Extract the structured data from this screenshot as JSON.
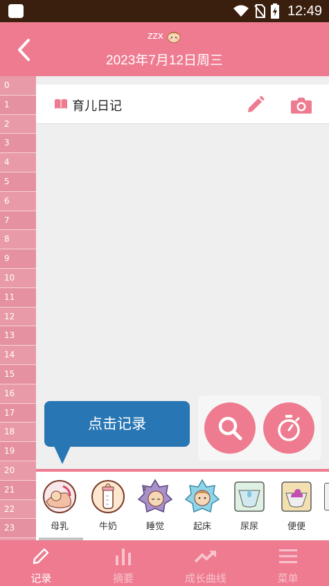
{
  "status_bar": {
    "time": "12:49"
  },
  "header": {
    "user_name": "zzx",
    "date": "2023年7月12日周三"
  },
  "ruler": {
    "hours": [
      "0",
      "1",
      "2",
      "3",
      "4",
      "5",
      "6",
      "7",
      "8",
      "9",
      "10",
      "11",
      "12",
      "13",
      "14",
      "15",
      "16",
      "17",
      "18",
      "19",
      "20",
      "21",
      "22",
      "23"
    ]
  },
  "diary": {
    "label": "育儿日记"
  },
  "tooltip": {
    "text": "点击记录"
  },
  "quick_items": [
    {
      "label": "母乳",
      "icon": "breastfeeding-icon"
    },
    {
      "label": "牛奶",
      "icon": "bottle-icon"
    },
    {
      "label": "睡觉",
      "icon": "sleep-icon"
    },
    {
      "label": "起床",
      "icon": "wake-up-icon"
    },
    {
      "label": "尿尿",
      "icon": "diaper-pee-icon"
    },
    {
      "label": "便便",
      "icon": "diaper-poop-icon"
    }
  ],
  "bottom_nav": [
    {
      "label": "记录",
      "icon": "pencil-icon",
      "active": true
    },
    {
      "label": "摘要",
      "icon": "bar-chart-icon",
      "active": false
    },
    {
      "label": "成长曲线",
      "icon": "trend-up-icon",
      "active": false
    },
    {
      "label": "菜单",
      "icon": "menu-icon",
      "active": false
    }
  ],
  "colors": {
    "primary": "#ee7b90",
    "ruler": "#e99aa9",
    "tooltip": "#2876b3",
    "status_bar": "#3a1f0e"
  }
}
